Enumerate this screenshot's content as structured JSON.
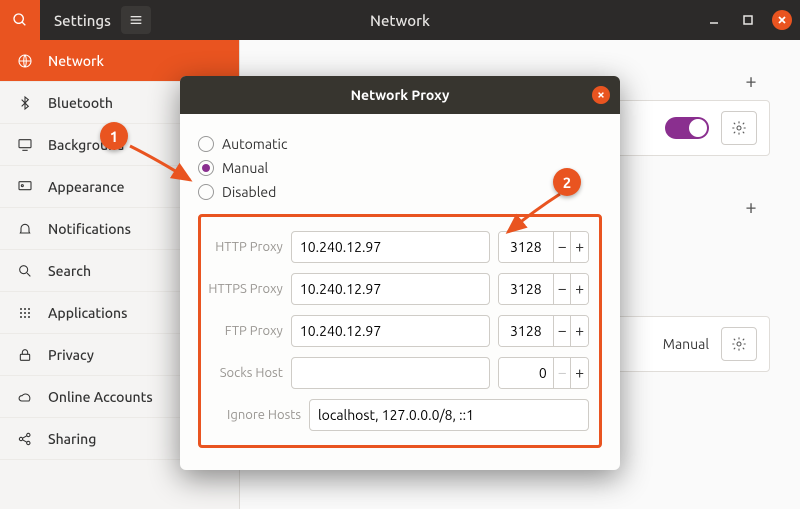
{
  "window": {
    "app_title": "Settings",
    "page_title": "Network"
  },
  "sidebar": {
    "items": [
      {
        "label": "Network",
        "icon": "globe"
      },
      {
        "label": "Bluetooth",
        "icon": "bluetooth"
      },
      {
        "label": "Background",
        "icon": "desktop"
      },
      {
        "label": "Appearance",
        "icon": "appearance"
      },
      {
        "label": "Notifications",
        "icon": "bell"
      },
      {
        "label": "Search",
        "icon": "search"
      },
      {
        "label": "Applications",
        "icon": "grid"
      },
      {
        "label": "Privacy",
        "icon": "lock"
      },
      {
        "label": "Online Accounts",
        "icon": "cloud"
      },
      {
        "label": "Sharing",
        "icon": "share"
      }
    ],
    "active": 0
  },
  "main": {
    "proxy_label": "Manual"
  },
  "modal": {
    "title": "Network Proxy",
    "modes": {
      "automatic": "Automatic",
      "manual": "Manual",
      "disabled": "Disabled",
      "selected": "manual"
    },
    "fields": {
      "http": {
        "label": "HTTP Proxy",
        "host": "10.240.12.97",
        "port": "3128"
      },
      "https": {
        "label": "HTTPS Proxy",
        "host": "10.240.12.97",
        "port": "3128"
      },
      "ftp": {
        "label": "FTP Proxy",
        "host": "10.240.12.97",
        "port": "3128"
      },
      "socks": {
        "label": "Socks Host",
        "host": "",
        "port": "0"
      },
      "ignore": {
        "label": "Ignore Hosts",
        "value": "localhost, 127.0.0.0/8, ::1"
      }
    }
  },
  "callouts": {
    "c1": "1",
    "c2": "2"
  }
}
